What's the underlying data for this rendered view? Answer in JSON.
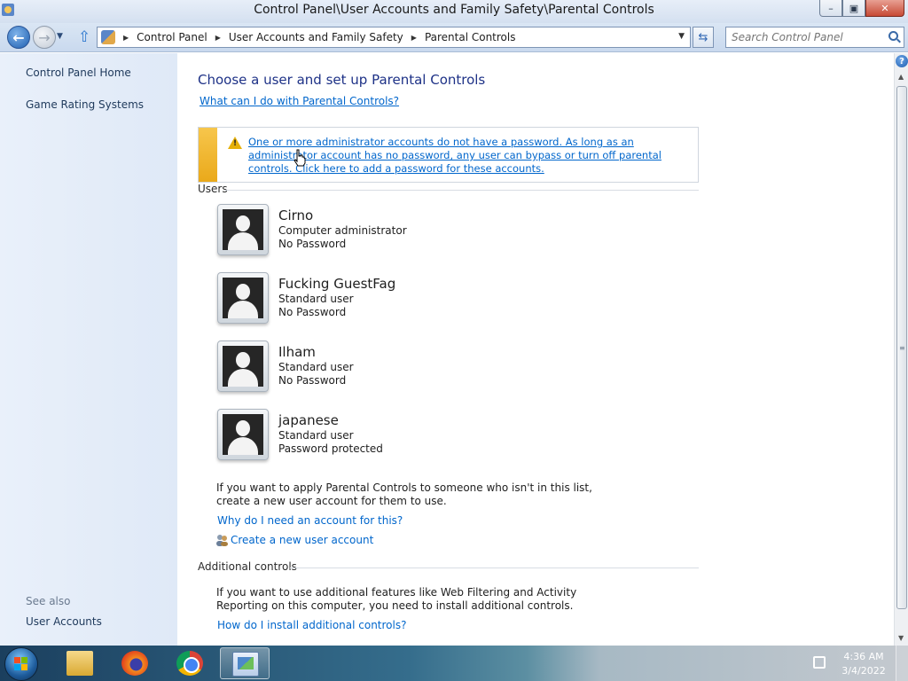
{
  "window": {
    "title": "Control Panel\\User Accounts and Family Safety\\Parental Controls",
    "minimize": "–",
    "maximize": "▣",
    "close": "✕"
  },
  "address": {
    "breadcrumb": [
      "Control Panel",
      "User Accounts and Family Safety",
      "Parental Controls"
    ],
    "search_placeholder": "Search Control Panel"
  },
  "sidebar": {
    "links": [
      "Control Panel Home",
      "Game Rating Systems"
    ],
    "see_also_label": "See also",
    "see_also_links": [
      "User Accounts"
    ]
  },
  "main": {
    "title": "Choose a user and set up Parental Controls",
    "what_link": "What can I do with Parental Controls?",
    "warning": "One or more administrator accounts do not have a password. As long as an administrator account has no password, any user can bypass or turn off parental controls. Click here to add a password for these accounts.",
    "users_heading": "Users",
    "users": [
      {
        "name": "Cirno",
        "type": "Computer administrator",
        "password": "No Password"
      },
      {
        "name": "Fucking GuestFag",
        "type": "Standard user",
        "password": "No Password"
      },
      {
        "name": "Ilham",
        "type": "Standard user",
        "password": "No Password"
      },
      {
        "name": "japanese",
        "type": "Standard user",
        "password": "Password protected"
      }
    ],
    "not_in_list_text_1": "If you want to apply Parental Controls to someone who isn't in this list,",
    "not_in_list_text_2": "create a new user account for them to use.",
    "why_link": "Why do I need an account for this?",
    "create_link": "Create a new user account",
    "additional_heading": "Additional controls",
    "additional_text_1": "If you want to use additional features like Web Filtering and Activity",
    "additional_text_2": "Reporting on this computer, you need to install additional controls.",
    "install_link": "How do I install additional controls?"
  },
  "taskbar": {
    "apps": [
      "folder-icon",
      "firefox-icon",
      "chrome-icon",
      "control-panel-icon"
    ],
    "time": "4:36 AM",
    "date": "3/4/2022"
  },
  "colors": {
    "link": "#0066cc",
    "title": "#1e3287",
    "warning_stripe": "#f0b72f",
    "sidebar_bg": "#e5eef9"
  }
}
